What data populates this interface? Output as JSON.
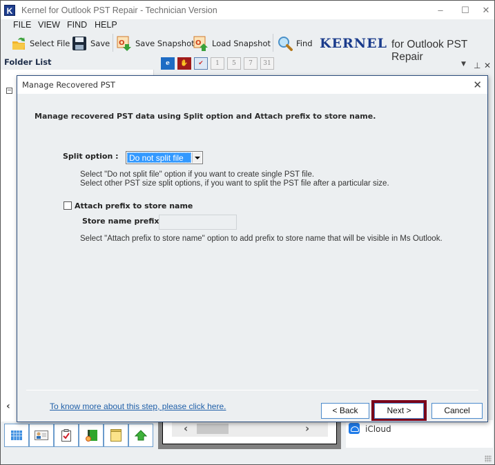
{
  "window": {
    "title": "Kernel for Outlook PST Repair - Technician Version",
    "app_icon_letter": "K",
    "controls": {
      "minimize": "–",
      "maximize": "☐",
      "close": "✕"
    }
  },
  "menu": [
    "FILE",
    "VIEW",
    "FIND",
    "HELP"
  ],
  "toolbar": {
    "select_file": "Select File",
    "save": "Save",
    "save_snapshot": "Save Snapshot",
    "load_snapshot": "Load Snapshot",
    "find": "Find",
    "brand_name": "KERNEL",
    "brand_product": "for Outlook PST Repair"
  },
  "folder_list": {
    "header": "Folder List"
  },
  "view_toolbar": {
    "icons": [
      "ie-icon",
      "stop-hand-icon",
      "calendar-check-icon",
      "day-1-icon",
      "day-5-icon",
      "day-7-icon",
      "day-31-icon",
      "mail-icon",
      "eml-icon",
      "txt-icon",
      "rtf-icon"
    ],
    "day_labels": [
      "1",
      "5",
      "7",
      "31"
    ]
  },
  "right_pane": {
    "icloud_label": "iCloud"
  },
  "bottom_tabs": [
    "calendar-icon",
    "contact-card-icon",
    "tasks-icon",
    "journal-icon",
    "notes-icon",
    "up-arrow-icon"
  ],
  "dialog": {
    "title": "Manage Recovered PST",
    "heading": "Manage recovered PST data using Split option and Attach prefix to store name.",
    "split_label": "Split option :",
    "split_value": "Do not split file",
    "split_hint_1": "Select \"Do not split file\" option if you want to create single PST file.",
    "split_hint_2": "Select other PST size split options, if you want to split the PST file after a particular size.",
    "attach_prefix_label": "Attach prefix to store name",
    "attach_prefix_checked": false,
    "store_prefix_label": "Store name prefix :",
    "store_prefix_value": "",
    "prefix_hint": "Select \"Attach prefix to store name\" option to add prefix to store name that will be visible in Ms Outlook.",
    "help_link": "To know more about this step, please click here.",
    "back_button": "< Back",
    "next_button": "Next >",
    "cancel_button": "Cancel",
    "highlight_color": "#7a0019"
  }
}
